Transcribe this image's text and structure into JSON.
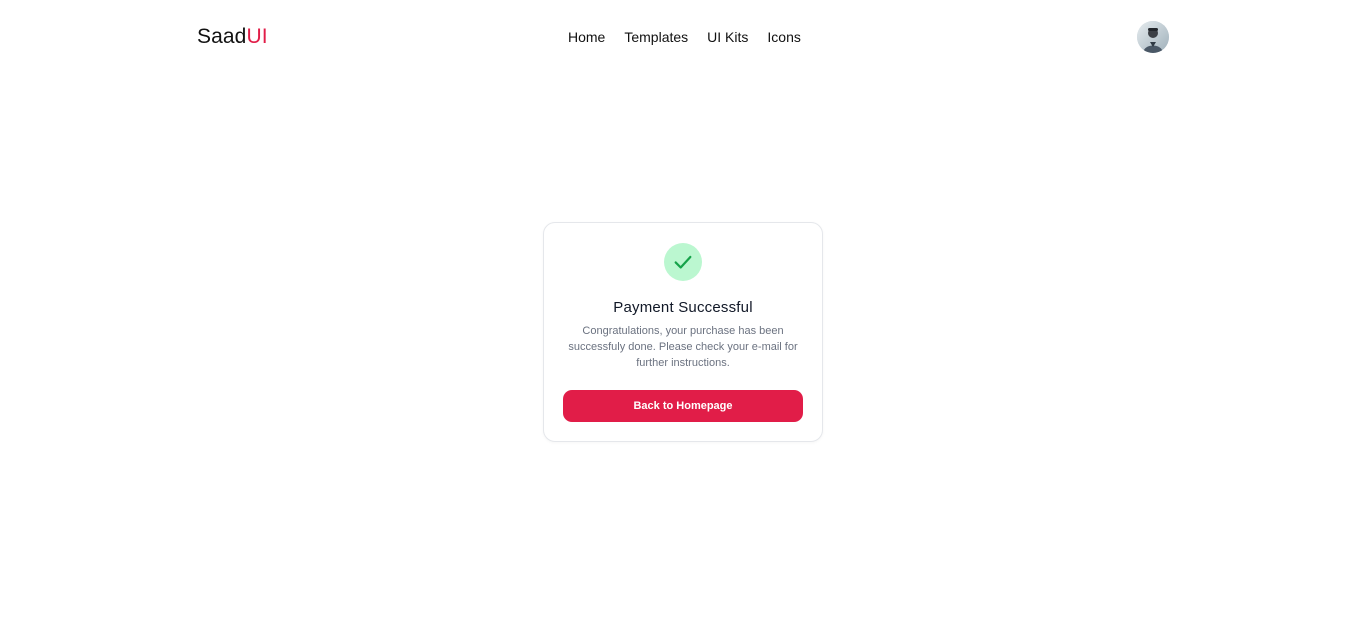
{
  "navbar": {
    "logo_main": "Saad",
    "logo_accent": "UI",
    "links": [
      {
        "label": "Home"
      },
      {
        "label": "Templates"
      },
      {
        "label": "UI Kits"
      },
      {
        "label": "Icons"
      }
    ],
    "avatar_icon": "user-avatar"
  },
  "card": {
    "icon": "check-icon",
    "title": "Payment Successful",
    "message": "Congratulations, your purchase has been successfuly done. Please check your e-mail for further instructions.",
    "button_label": "Back to Homepage"
  },
  "colors": {
    "accent": "#e11d48",
    "success_bg": "#bbf7d0",
    "success_check": "#16a34a",
    "muted_text": "#6b7280",
    "card_border": "#e5e7eb"
  }
}
